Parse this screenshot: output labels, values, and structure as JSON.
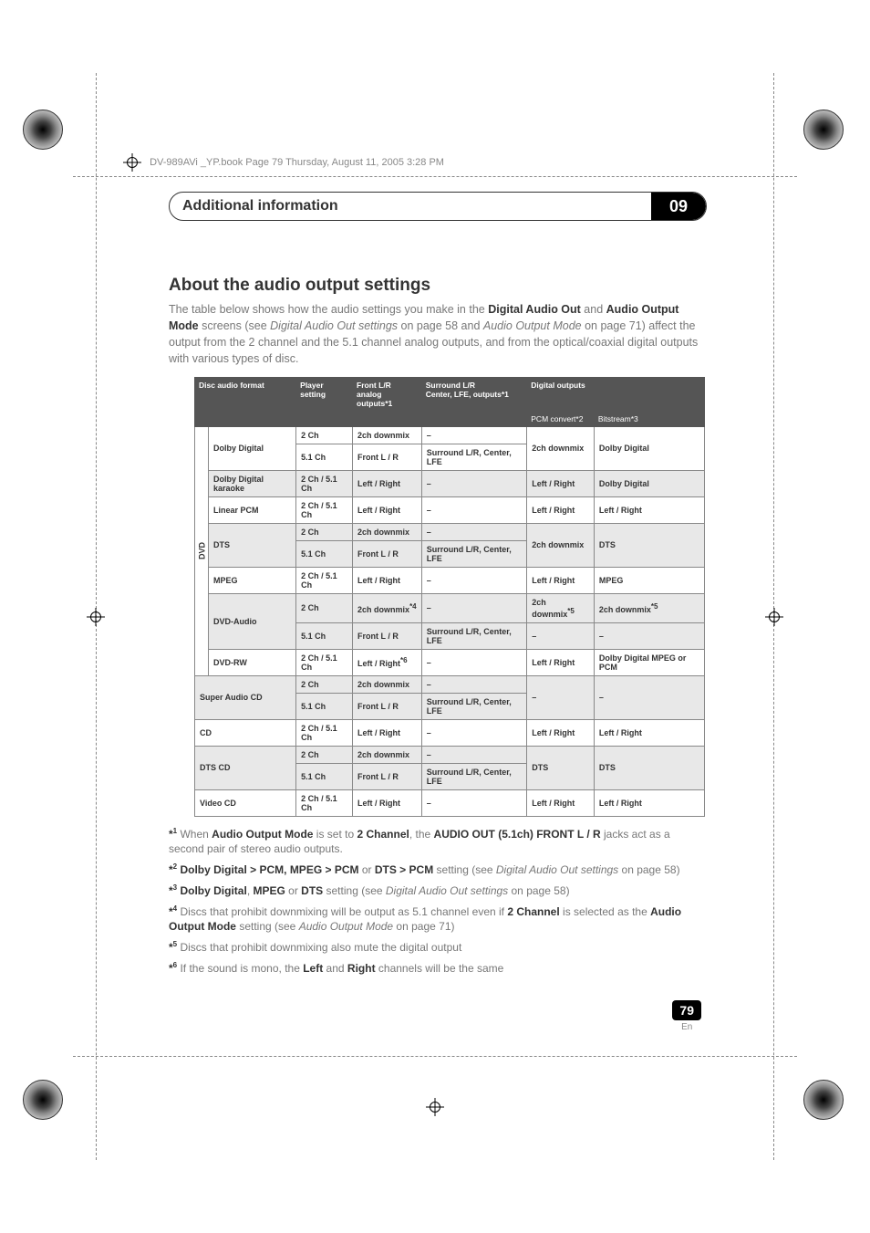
{
  "meta": {
    "header_line": "DV-989AVi _YP.book  Page 79  Thursday, August 11, 2005  3:28 PM"
  },
  "chapter": {
    "title": "Additional information",
    "number": "09"
  },
  "section": {
    "heading": "About the audio output settings",
    "intro_prefix": "The table below shows how the audio settings you make in the ",
    "intro_b1": "Digital Audio Out",
    "intro_mid1": " and ",
    "intro_b2": "Audio Output Mode",
    "intro_mid2": " screens (see ",
    "intro_i1": "Digital Audio Out settings",
    "intro_mid3": " on page 58 and ",
    "intro_i2": "Audio Output Mode",
    "intro_mid4": " on page 71) affect the output from the 2 channel and the 5.1 channel analog outputs, and from the optical/coaxial digital outputs with various types of disc."
  },
  "table": {
    "headers": {
      "disc": "Disc audio format",
      "player": "Player setting",
      "front": "Front L/R",
      "front_sub": "analog outputs*1",
      "surround": "Surround L/R",
      "surround_sub": "Center, LFE, outputs*1",
      "digital": "Digital outputs",
      "digital_sub1": "PCM convert*2",
      "digital_sub2": "Bitstream*3"
    },
    "dvd_label": "DVD",
    "rows": [
      {
        "fmt": "Dolby Digital",
        "ps": "2 Ch",
        "front": "2ch downmix",
        "surr": "–",
        "d1": "2ch downmix",
        "d2": "Dolby Digital",
        "shade": false,
        "span_surr": false,
        "span_d": true
      },
      {
        "fmt": "",
        "ps": "5.1 Ch",
        "front": "Front L / R",
        "surr": "Surround L/R, Center, LFE",
        "d1": "",
        "d2": "",
        "shade": false
      },
      {
        "fmt": "Dolby Digital karaoke",
        "ps": "2 Ch / 5.1 Ch",
        "front": "Left / Right",
        "surr": "–",
        "d1": "Left / Right",
        "d2": "Dolby Digital",
        "shade": true
      },
      {
        "fmt": "Linear PCM",
        "ps": "2 Ch / 5.1 Ch",
        "front": "Left / Right",
        "surr": "–",
        "d1": "Left / Right",
        "d2": "Left / Right",
        "shade": false
      },
      {
        "fmt": "DTS",
        "ps": "2 Ch",
        "front": "2ch downmix",
        "surr": "–",
        "d1": "2ch downmix",
        "d2": "DTS",
        "shade": true,
        "span_d": true
      },
      {
        "fmt": "",
        "ps": "5.1 Ch",
        "front": "Front L / R",
        "surr": "Surround L/R, Center, LFE",
        "d1": "",
        "d2": "",
        "shade": true
      },
      {
        "fmt": "MPEG",
        "ps": "2 Ch / 5.1 Ch",
        "front": "Left / Right",
        "surr": "–",
        "d1": "Left / Right",
        "d2": "MPEG",
        "shade": false
      },
      {
        "fmt": "DVD-Audio",
        "ps": "2 Ch",
        "front": "2ch downmix*4",
        "surr": "–",
        "d1": "2ch downmix*5",
        "d2": "2ch downmix*5",
        "shade": true
      },
      {
        "fmt": "",
        "ps": "5.1 Ch",
        "front": "Front L / R",
        "surr": "Surround L/R, Center, LFE",
        "d1": "–",
        "d2": "–",
        "shade": true
      },
      {
        "fmt": "DVD-RW",
        "ps": "2 Ch / 5.1 Ch",
        "front": "Left / Right*6",
        "surr": "–",
        "d1": "Left / Right",
        "d2": "Dolby Digital MPEG or PCM",
        "shade": false
      },
      {
        "fmt": "Super Audio CD",
        "ps": "2 Ch",
        "front": "2ch downmix",
        "surr": "–",
        "d1": "–",
        "d2": "–",
        "shade": true,
        "span_d": true,
        "outside": true
      },
      {
        "fmt": "",
        "ps": "5.1 Ch",
        "front": "Front L / R",
        "surr": "Surround L/R, Center, LFE",
        "d1": "",
        "d2": "",
        "shade": true,
        "outside": true
      },
      {
        "fmt": "CD",
        "ps": "2 Ch / 5.1 Ch",
        "front": "Left / Right",
        "surr": "–",
        "d1": "Left / Right",
        "d2": "Left / Right",
        "shade": false,
        "outside": true
      },
      {
        "fmt": "DTS CD",
        "ps": "2 Ch",
        "front": "2ch downmix",
        "surr": "–",
        "d1": "DTS",
        "d2": "DTS",
        "shade": true,
        "span_d": true,
        "outside": true
      },
      {
        "fmt": "",
        "ps": "5.1 Ch",
        "front": "Front L / R",
        "surr": "Surround L/R, Center, LFE",
        "d1": "",
        "d2": "",
        "shade": true,
        "outside": true
      },
      {
        "fmt": "Video CD",
        "ps": "2 Ch / 5.1 Ch",
        "front": "Left / Right",
        "surr": "–",
        "d1": "Left / Right",
        "d2": "Left / Right",
        "shade": false,
        "outside": true
      }
    ]
  },
  "footnotes": {
    "f1_pre": "When ",
    "f1_b1": "Audio Output Mode",
    "f1_m1": " is set to ",
    "f1_b2": "2 Channel",
    "f1_m2": ", the ",
    "f1_b3": "AUDIO OUT (5.1ch) FRONT L / R",
    "f1_end": " jacks act as a second pair of stereo audio outputs.",
    "f2_b": "Dolby Digital > PCM, MPEG > PCM",
    "f2_m": " or ",
    "f2_b2": "DTS > PCM",
    "f2_m2": " setting (see ",
    "f2_i": "Digital Audio Out settings",
    "f2_end": " on page 58)",
    "f3_b": "Dolby Digital",
    "f3_m": ", ",
    "f3_b2": "MPEG",
    "f3_m2": " or ",
    "f3_b3": "DTS",
    "f3_m3": " setting (see ",
    "f3_i": "Digital Audio Out settings",
    "f3_end": " on page 58)",
    "f4_pre": "Discs that prohibit downmixing will be output as 5.1 channel even if ",
    "f4_b": "2 Channel",
    "f4_m": " is selected as the ",
    "f4_b2": "Audio Output Mode",
    "f4_m2": " setting (see ",
    "f4_i": "Audio Output Mode",
    "f4_end": " on page 71)",
    "f5": "Discs that prohibit downmixing also mute the digital output",
    "f6_pre": "If the sound is mono, the ",
    "f6_b1": "Left",
    "f6_m": " and ",
    "f6_b2": "Right",
    "f6_end": " channels will be the same"
  },
  "page": {
    "number": "79",
    "lang": "En"
  }
}
